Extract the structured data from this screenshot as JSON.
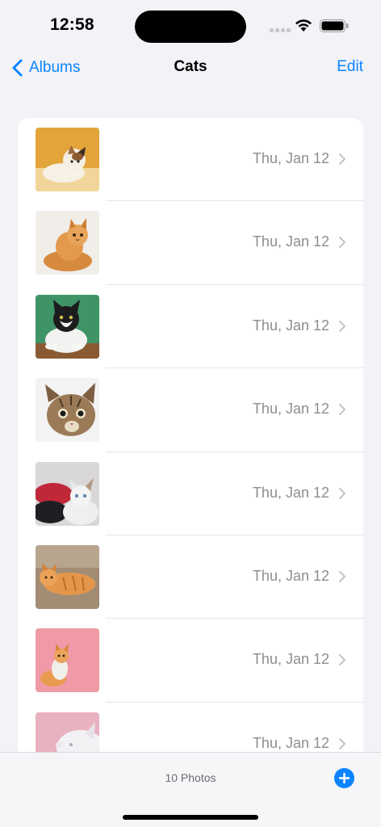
{
  "status_bar": {
    "time": "12:58",
    "icons": [
      "cellular-signal-icon",
      "wifi-icon",
      "battery-icon"
    ]
  },
  "nav": {
    "back_label": "Albums",
    "title": "Cats",
    "edit_label": "Edit"
  },
  "photos": [
    {
      "date": "Thu, Jan 12",
      "thumb": "calico-kitten-photo"
    },
    {
      "date": "Thu, Jan 12",
      "thumb": "orange-cat-photo"
    },
    {
      "date": "Thu, Jan 12",
      "thumb": "tuxedo-cat-photo"
    },
    {
      "date": "Thu, Jan 12",
      "thumb": "tabby-cat-photo"
    },
    {
      "date": "Thu, Jan 12",
      "thumb": "white-kitten-photo"
    },
    {
      "date": "Thu, Jan 12",
      "thumb": "ginger-cat-lying-photo"
    },
    {
      "date": "Thu, Jan 12",
      "thumb": "ginger-kitten-pink-photo"
    },
    {
      "date": "Thu, Jan 12",
      "thumb": "white-cat-pink-photo"
    }
  ],
  "toolbar": {
    "count_label": "10 Photos"
  },
  "colors": {
    "accent": "#0a84ff",
    "background": "#f2f2f7",
    "secondary_text": "#8e8e93"
  }
}
